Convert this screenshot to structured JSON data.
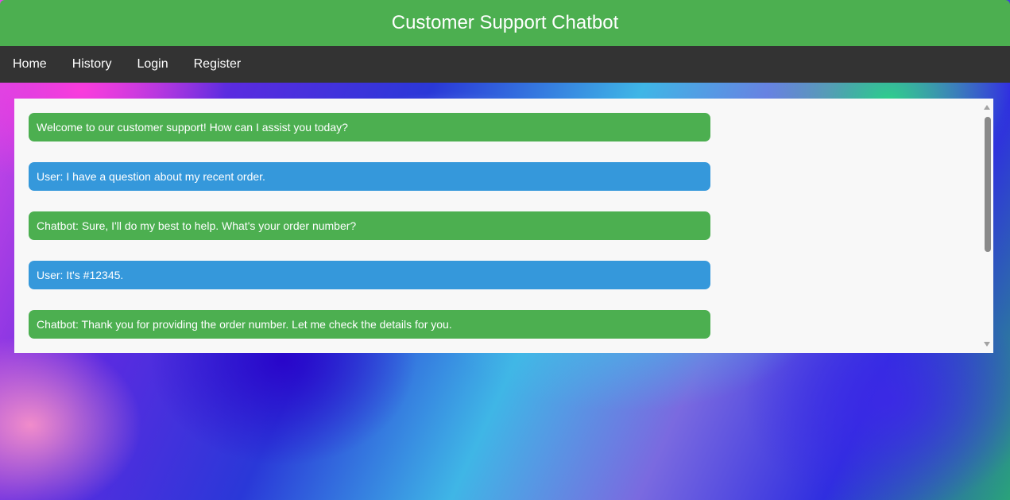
{
  "header": {
    "title": "Customer Support Chatbot"
  },
  "nav": {
    "items": [
      {
        "label": "Home"
      },
      {
        "label": "History"
      },
      {
        "label": "Login"
      },
      {
        "label": "Register"
      }
    ]
  },
  "chat": {
    "messages": [
      {
        "role": "bot",
        "text": "Welcome to our customer support! How can I assist you today?"
      },
      {
        "role": "user",
        "text": "User: I have a question about my recent order."
      },
      {
        "role": "bot",
        "text": "Chatbot: Sure, I'll do my best to help. What's your order number?"
      },
      {
        "role": "user",
        "text": "User: It's #12345."
      },
      {
        "role": "bot",
        "text": "Chatbot: Thank you for providing the order number. Let me check the details for you."
      }
    ]
  },
  "colors": {
    "header_bg": "#4caf50",
    "nav_bg": "#333333",
    "bot_bubble": "#4caf50",
    "user_bubble": "#3598db"
  }
}
